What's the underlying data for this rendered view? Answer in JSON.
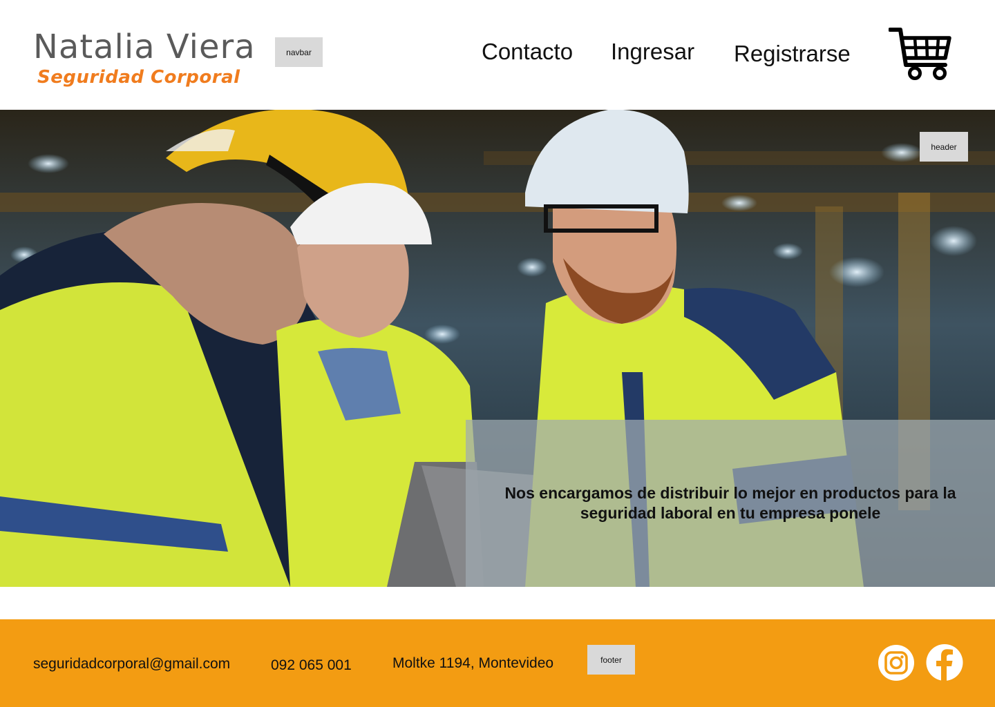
{
  "navbar": {
    "logo_name": "Natalia Viera",
    "logo_tagline": "Seguridad Corporal",
    "tag_label": "navbar",
    "links": [
      "Contacto",
      "Ingresar",
      "Registrarse"
    ],
    "cart_icon": "shopping-cart-icon"
  },
  "hero": {
    "tag_label": "header",
    "message": "Nos encargamos de distribuir lo mejor en productos para la seguridad laboral en tu empresa ponele"
  },
  "footer": {
    "email": "seguridadcorporal@gmail.com",
    "phone": "092 065 001",
    "address": "Moltke 1194, Montevideo",
    "tag_label": "footer",
    "social_icons": [
      "instagram-icon",
      "facebook-icon"
    ]
  },
  "colors": {
    "brand_orange": "#f39c12",
    "logo_orange": "#f07c1e",
    "logo_gray": "#5a5a5a",
    "hi_vis_yellow": "#d8e83a"
  }
}
